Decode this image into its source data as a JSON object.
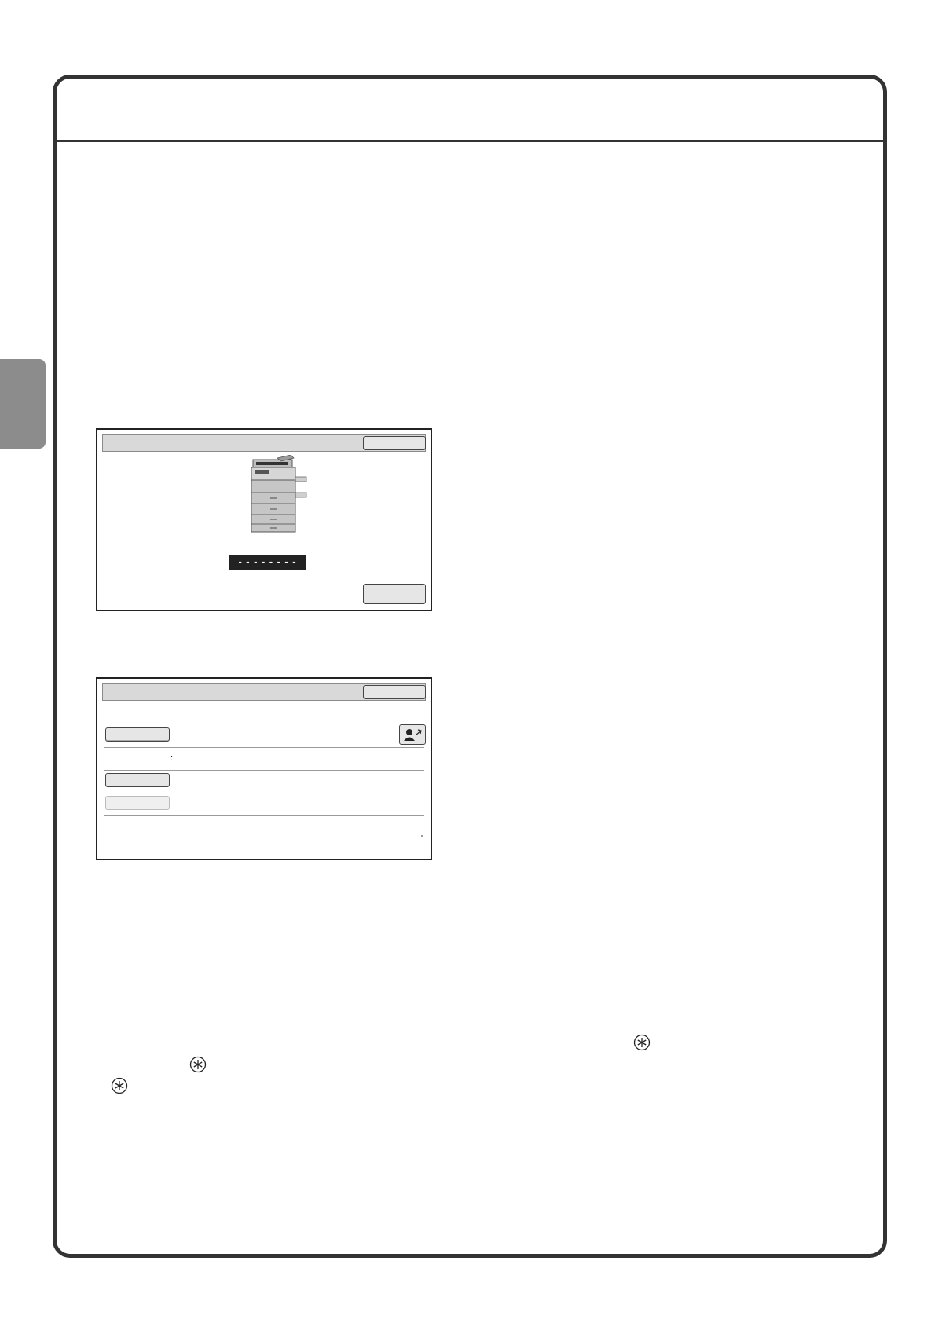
{
  "panel1": {
    "code_display": "--------"
  },
  "panel2": {
    "colon": ":"
  }
}
